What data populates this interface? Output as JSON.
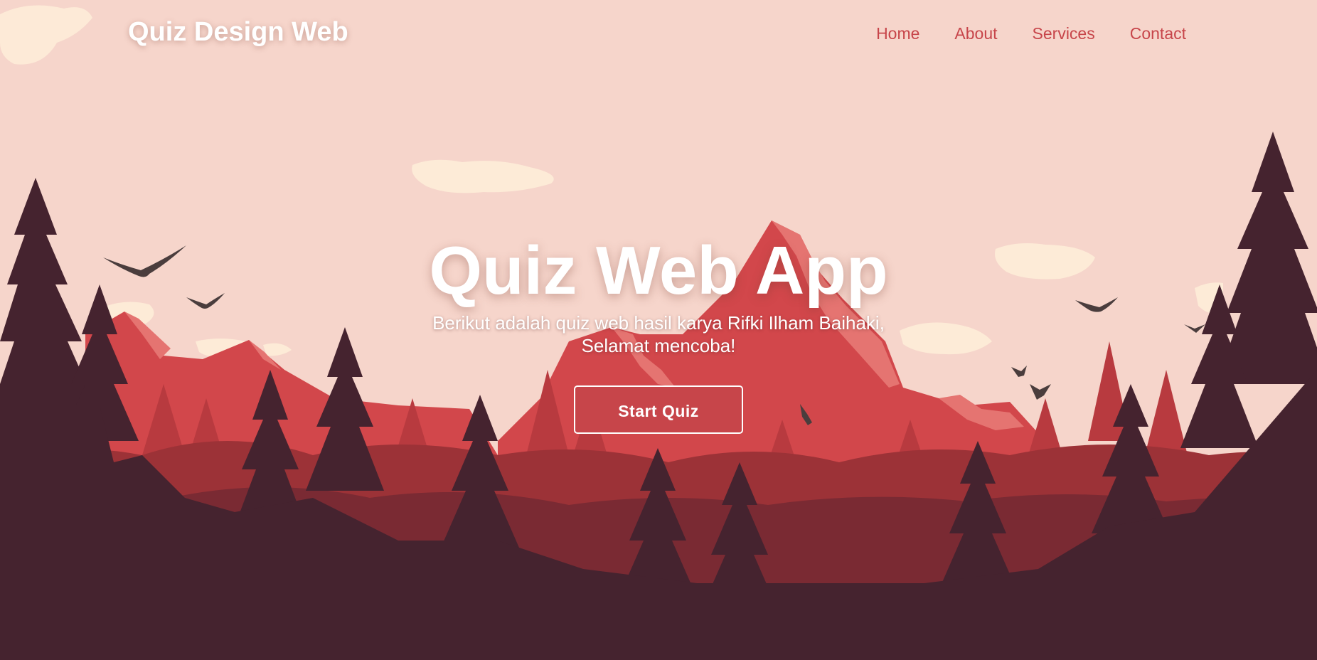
{
  "header": {
    "brand": "Quiz Design Web",
    "nav": [
      {
        "label": "Home"
      },
      {
        "label": "About"
      },
      {
        "label": "Services"
      },
      {
        "label": "Contact"
      }
    ]
  },
  "hero": {
    "title": "Quiz Web App",
    "subtitle": "Berikut adalah quiz web hasil karya Rifki Ilham Baihaki, Selamat mencoba!",
    "cta_label": "Start Quiz"
  },
  "colors": {
    "sky": "#f6d5cb",
    "accent": "#c7454a",
    "mountain": "#d2474b",
    "forest_dark": "#45232f",
    "cloud": "#fdebd7"
  },
  "background": {
    "scene": "mountain-forest-landscape",
    "icons": [
      "cloud-icon",
      "bird-icon",
      "mountain-icon",
      "pine-tree-icon"
    ]
  }
}
